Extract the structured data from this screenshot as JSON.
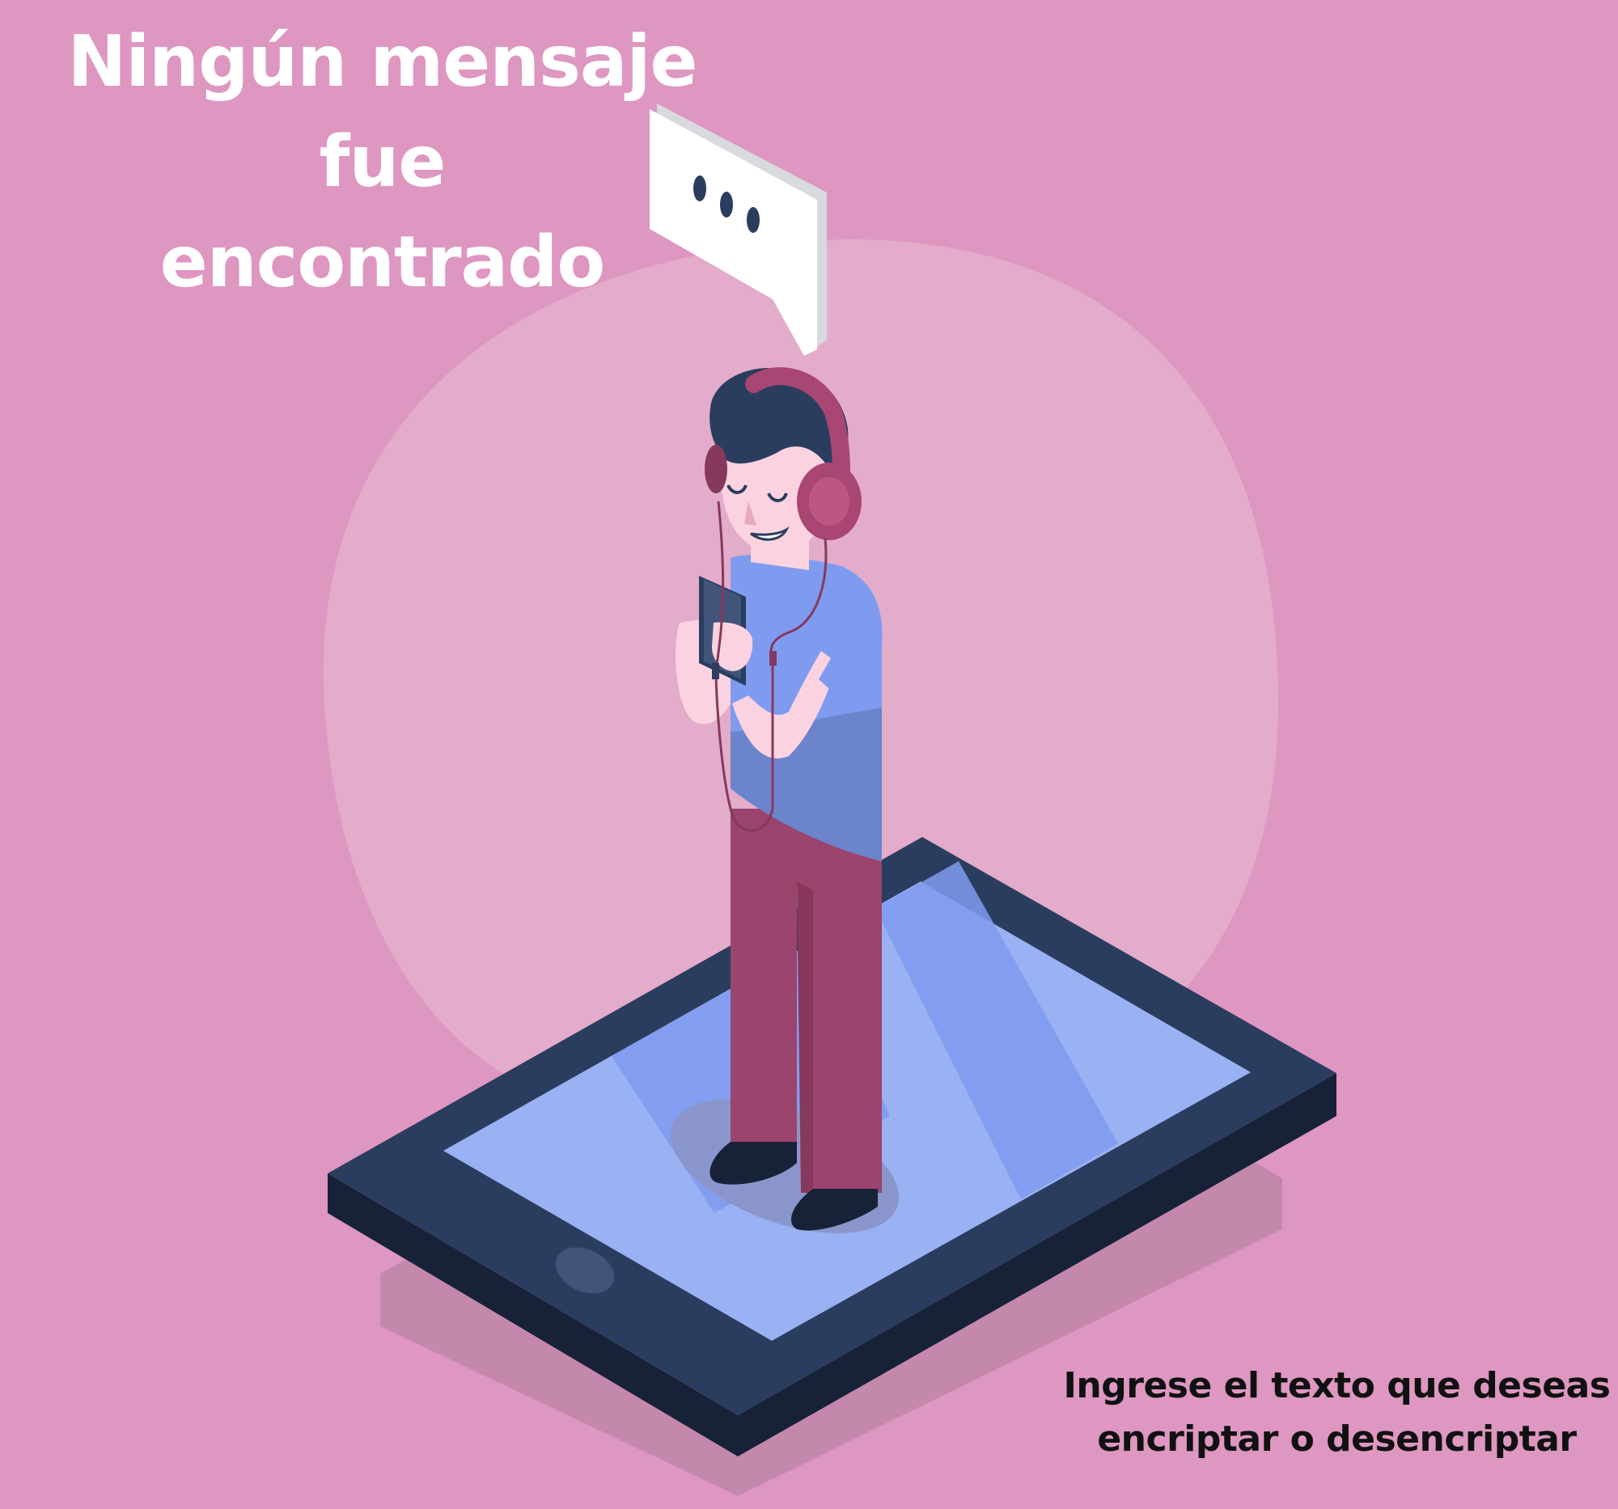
{
  "empty_state": {
    "title_line1": "Ningún mensaje fue",
    "title_line2": "encontrado",
    "instruction_line1": "Ingrese el texto que deseas",
    "instruction_line2": "encriptar o desencriptar"
  },
  "colors": {
    "background": "#de97c1",
    "blob": "#e3acca",
    "tablet_frame": "#2b3d5f",
    "tablet_screen": "#9ab1f3",
    "shirt": "#7f9bef",
    "pants": "#9b446d",
    "headphones": "#a94673"
  },
  "illustration": {
    "icon": "person-with-headphones-on-tablet-illustration"
  }
}
